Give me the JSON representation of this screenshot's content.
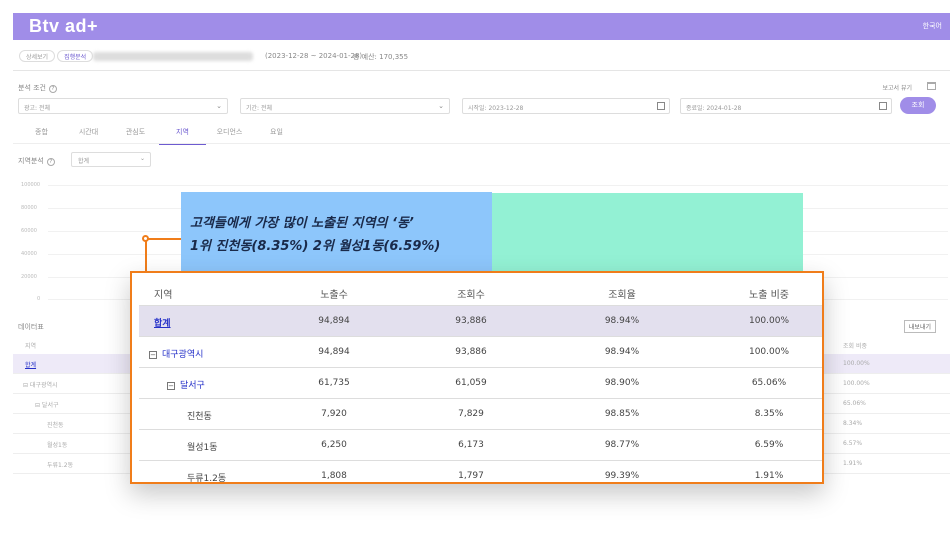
{
  "app": {
    "logo": "Btv ad+",
    "lang": "한국어"
  },
  "header": {
    "crumbs": [
      "상세보기",
      "집행분석"
    ],
    "period": "(2023-12-28 ~ 2024-01-28)",
    "budget": "총 예산: 170,355"
  },
  "conditions": {
    "label": "분석 조건",
    "report_setting": "보고서 뷰기",
    "ad_select": "광고: 전체",
    "period_select": "기간: 전체",
    "start_date": "시작일: 2023-12-28",
    "end_date": "종료일: 2024-01-28",
    "query_button": "조회"
  },
  "tabs": [
    "종합",
    "시간대",
    "관심도",
    "지역",
    "오디언스",
    "요일"
  ],
  "active_tab": 3,
  "region_analysis": {
    "label": "지역분석",
    "select": "합계"
  },
  "chart_axis": {
    "ticks": [
      "100000",
      "80000",
      "60000",
      "40000",
      "20000",
      "0"
    ]
  },
  "bg_table": {
    "title": "데이터표",
    "export": "내보내기",
    "head_left": "지역",
    "head_right": "조회 비중",
    "rows": [
      {
        "name": "합계",
        "right": "100.00%"
      },
      {
        "name": "⊟ 대구광역시",
        "right": "100.00%"
      },
      {
        "name": "⊟ 달서구",
        "right": "65.06%"
      },
      {
        "name": "진천동",
        "right": "8.34%"
      },
      {
        "name": "월성1동",
        "right": "6.57%"
      },
      {
        "name": "두류1.2동",
        "right": "1.91%"
      }
    ]
  },
  "callout": {
    "line1": "고객들에게 가장 많이 노출된 지역의 ‘동’",
    "line2": "1위 진천동(8.35%) 2위 월성1동(6.59%)"
  },
  "table": {
    "headers": [
      "지역",
      "노출수",
      "조회수",
      "조회율",
      "노출 비중"
    ],
    "rows": [
      {
        "region": "합계",
        "impressions": "94,894",
        "views": "93,886",
        "rate": "98.94%",
        "share": "100.00%"
      },
      {
        "region": "대구광역시",
        "impressions": "94,894",
        "views": "93,886",
        "rate": "98.94%",
        "share": "100.00%"
      },
      {
        "region": "달서구",
        "impressions": "61,735",
        "views": "61,059",
        "rate": "98.90%",
        "share": "65.06%"
      },
      {
        "region": "진천동",
        "impressions": "7,920",
        "views": "7,829",
        "rate": "98.85%",
        "share": "8.35%"
      },
      {
        "region": "월성1동",
        "impressions": "6,250",
        "views": "6,173",
        "rate": "98.77%",
        "share": "6.59%"
      },
      {
        "region": "두류1.2동",
        "impressions": "1,808",
        "views": "1,797",
        "rate": "99.39%",
        "share": "1.91%"
      }
    ]
  },
  "colors": {
    "brand": "#a08de8",
    "highlight": "#f07d1a",
    "link": "#2530c8"
  }
}
